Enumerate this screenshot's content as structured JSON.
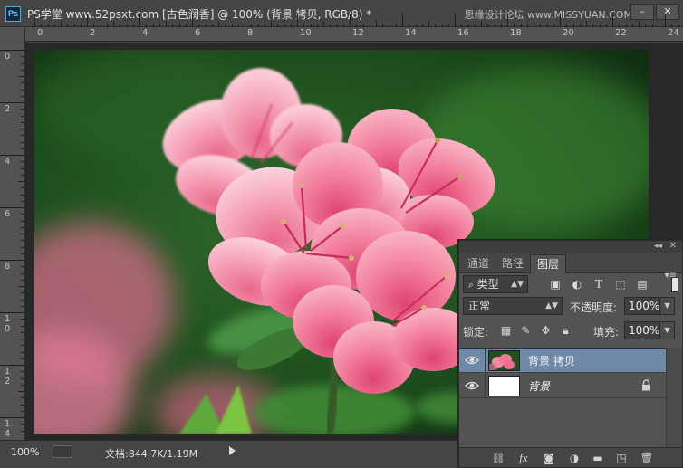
{
  "window": {
    "app_icon": "Ps",
    "title": "PS学堂 www.52psxt.com [古色润香] @ 100% (背景 拷贝, RGB/8) *",
    "watermark": "思缘设计论坛 www.MISSYUAN.COM"
  },
  "ruler": {
    "h_labels": [
      "0",
      "2",
      "4",
      "6",
      "8",
      "10",
      "12",
      "14",
      "16",
      "18",
      "20",
      "22",
      "24"
    ],
    "v_labels": [
      "0",
      "2",
      "4",
      "6",
      "8",
      "10",
      "12",
      "14"
    ]
  },
  "status": {
    "zoom": "100%",
    "doc_info": "文档:844.7K/1.19M"
  },
  "layers_panel": {
    "tabs": [
      {
        "label": "通道",
        "active": false
      },
      {
        "label": "路径",
        "active": false
      },
      {
        "label": "图层",
        "active": true
      }
    ],
    "filter": {
      "label": "类型",
      "icons": [
        "image-filter-icon",
        "adjustment-filter-icon",
        "type-filter-icon",
        "shape-filter-icon",
        "smart-object-filter-icon"
      ]
    },
    "blend_mode": "正常",
    "opacity_label": "不透明度:",
    "opacity_value": "100%",
    "lock_label": "锁定:",
    "fill_label": "填充:",
    "fill_value": "100%",
    "layers": [
      {
        "name": "背景 拷贝",
        "selected": true,
        "locked": false,
        "visible": true,
        "thumb": "photo"
      },
      {
        "name": "背景",
        "selected": false,
        "locked": true,
        "visible": true,
        "thumb": "white"
      }
    ],
    "footer_icons": [
      "link-layers-icon",
      "fx-icon",
      "add-mask-icon",
      "adjustment-layer-icon",
      "new-group-icon",
      "new-layer-icon",
      "delete-layer-icon"
    ],
    "footer_fx": "fx"
  },
  "colors": {
    "selected_layer": "#6f89a8",
    "panel_bg": "#535353",
    "flower_pink": "#f07a9a"
  }
}
